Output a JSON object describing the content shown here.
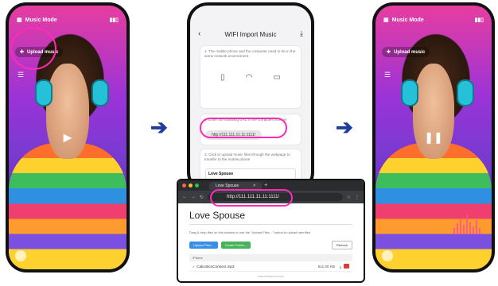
{
  "left_phone": {
    "mode_label": "Music Mode",
    "upload_label": "Upload music"
  },
  "middle_phone": {
    "title": "WIFI Import Music",
    "step1": "1. The mobile phone and the computer need to be in the same network environment",
    "step2": "2. Enter the following URL in the computer browser",
    "url": "http://111.111.11.11:1111/",
    "step3": "3. Click to upload music files through the webpage to transfer to the mobile phone",
    "mini_title": "Love Spouse"
  },
  "browser": {
    "tab_title": "Love Spouse",
    "address": "http://111.111.11.11:1111/",
    "page_title": "Love Spouse",
    "description": "Drag & drop files on this window or use the \"Upload Files...\" button to upload new files",
    "upload_button": "Upload Files...",
    "create_button": "Create Folder...",
    "refresh_button": "Refresh",
    "file_header": "/Phone",
    "file_name": "CalicoticoConnect.mp3",
    "file_size": "6x1.00 KB",
    "footer": "www.lovespouse.com"
  },
  "right_phone": {
    "mode_label": "Music Mode",
    "upload_label": "Upload music"
  },
  "colors": {
    "highlight": "#ff2ab8",
    "arrow": "#1f3c9c"
  }
}
